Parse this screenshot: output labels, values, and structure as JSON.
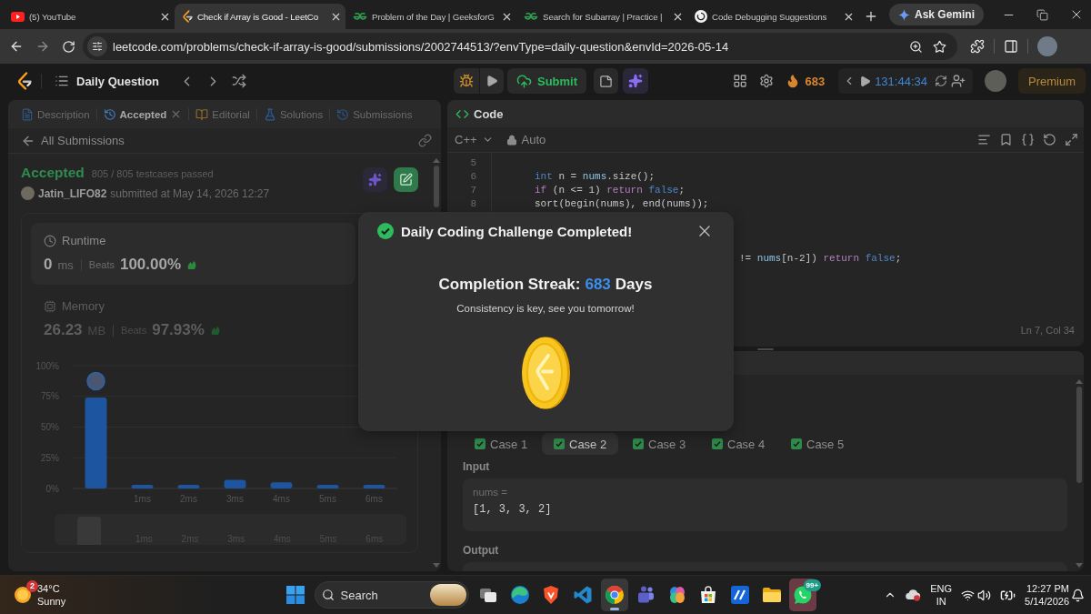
{
  "browser": {
    "tabs": [
      {
        "kind": "youtube",
        "title": "(5) YouTube",
        "selected": false
      },
      {
        "kind": "leetcode",
        "title": "Check if Array is Good - LeetCo",
        "selected": true
      },
      {
        "kind": "gfg",
        "title": "Problem of the Day | GeeksforG",
        "selected": false
      },
      {
        "kind": "gfg",
        "title": "Search for Subarray | Practice |",
        "selected": false
      },
      {
        "kind": "chat",
        "title": "Code Debugging Suggestions",
        "selected": false
      }
    ],
    "gemini": "Ask Gemini",
    "url": "leetcode.com/problems/check-if-array-is-good/submissions/2002744513/?envType=daily-question&envId=2026-05-14"
  },
  "nav": {
    "title": "Daily Question",
    "submit": "Submit",
    "streak": "683",
    "timer": "131:44:34",
    "premium": "Premium"
  },
  "left": {
    "tabs": [
      {
        "label": "Description",
        "selected": false,
        "closable": false
      },
      {
        "label": "Accepted",
        "selected": true,
        "closable": true
      },
      {
        "label": "Editorial",
        "selected": false,
        "closable": false
      },
      {
        "label": "Solutions",
        "selected": false,
        "closable": false
      },
      {
        "label": "Submissions",
        "selected": false,
        "closable": false
      }
    ],
    "back": "All Submissions",
    "result": {
      "status": "Accepted",
      "testcases": "805 / 805 testcases passed",
      "user": "Jatin_LIFO82",
      "submitted": "submitted at May 14, 2026 12:27"
    },
    "stats": [
      {
        "kind": "runtime",
        "label": "Runtime",
        "value": "0",
        "unit": "ms",
        "beats_label": "Beats",
        "beats": "100.00%",
        "selected": true
      },
      {
        "kind": "memory",
        "label": "Memory",
        "value": "26.23",
        "unit": "MB",
        "beats_label": "Beats",
        "beats": "97.93%",
        "selected": false
      }
    ],
    "chart_data": {
      "type": "bar",
      "categories": [
        null,
        "1ms",
        "2ms",
        "3ms",
        "4ms",
        "5ms",
        "6ms"
      ],
      "values": [
        74,
        3,
        3,
        7,
        5,
        3,
        3
      ],
      "ylim": [
        0,
        100
      ],
      "yticks": [
        {
          "value": 0,
          "label": "0%"
        },
        {
          "value": 25,
          "label": "25%"
        },
        {
          "value": 50,
          "label": "50%"
        },
        {
          "value": 75,
          "label": "75%"
        },
        {
          "value": 100,
          "label": "100%"
        }
      ],
      "grid": true
    },
    "navigator": [
      "1ms",
      "2ms",
      "3ms",
      "4ms",
      "5ms",
      "6ms"
    ]
  },
  "editor": {
    "title": "Code",
    "language": "C++",
    "mode": "Auto",
    "lines": [
      {
        "number": "5"
      },
      {
        "number": "6",
        "tokens": [
          {
            "kind": "type",
            "text": "int"
          },
          {
            "kind": "plain",
            "text": " n = "
          },
          {
            "kind": "var",
            "text": "nums"
          },
          {
            "kind": "plain",
            "text": ".size();"
          }
        ]
      },
      {
        "number": "7",
        "tokens": [
          {
            "kind": "control",
            "text": "if"
          },
          {
            "kind": "plain",
            "text": " (n <= 1) "
          },
          {
            "kind": "control",
            "text": "return "
          },
          {
            "kind": "type",
            "text": "false"
          },
          {
            "kind": "plain",
            "text": ";"
          }
        ]
      },
      {
        "number": "8",
        "tokens": [
          {
            "kind": "plain",
            "text": "sort(begin(nums), end(nums));"
          }
        ]
      }
    ],
    "partial_lines": [
      {
        "tokens": [
          {
            "kind": "plain",
            "text": "!= "
          },
          {
            "kind": "var",
            "text": "nums"
          },
          {
            "kind": "plain",
            "text": "[n-2]) "
          },
          {
            "kind": "control",
            "text": "return "
          },
          {
            "kind": "type",
            "text": "false"
          },
          {
            "kind": "plain",
            "text": ";"
          }
        ]
      }
    ],
    "cursor": "Ln 7, Col 34"
  },
  "tests": {
    "cases": [
      {
        "label": "Case 1",
        "selected": false,
        "passed": true
      },
      {
        "label": "Case 2",
        "selected": true,
        "passed": true
      },
      {
        "label": "Case 3",
        "selected": false,
        "passed": true
      },
      {
        "label": "Case 4",
        "selected": false,
        "passed": true
      },
      {
        "label": "Case 5",
        "selected": false,
        "passed": true
      }
    ],
    "input_label": "Input",
    "param": "nums =",
    "value": "[1, 3, 3, 2]",
    "output_label": "Output"
  },
  "dialog": {
    "title": "Daily Coding Challenge Completed!",
    "streak_label": "Completion Streak:",
    "streak": "683",
    "unit": "Days",
    "message": "Consistency is key, see you tomorrow!"
  },
  "taskbar": {
    "weather": {
      "badge": "2",
      "temperature": "34°C",
      "condition": "Sunny"
    },
    "search": {
      "placeholder": "Search"
    },
    "apps": [
      {
        "kind": "taskview",
        "selected": false,
        "flashing": false
      },
      {
        "kind": "edge",
        "selected": false,
        "flashing": false
      },
      {
        "kind": "brave",
        "selected": false,
        "flashing": false
      },
      {
        "kind": "vscode",
        "selected": false,
        "flashing": false
      },
      {
        "kind": "chrome",
        "selected": true,
        "flashing": false
      },
      {
        "kind": "teams",
        "selected": false,
        "flashing": false
      },
      {
        "kind": "copilot",
        "selected": false,
        "flashing": false
      },
      {
        "kind": "store",
        "selected": false,
        "flashing": false
      },
      {
        "kind": "tool",
        "selected": false,
        "flashing": false
      },
      {
        "kind": "explorer",
        "selected": false,
        "flashing": false
      },
      {
        "kind": "whatsapp",
        "selected": false,
        "flashing": true,
        "badge": "99+"
      }
    ],
    "tray": {
      "language": "ENG",
      "region": "IN",
      "time": "12:27 PM",
      "date": "5/14/2026"
    }
  }
}
